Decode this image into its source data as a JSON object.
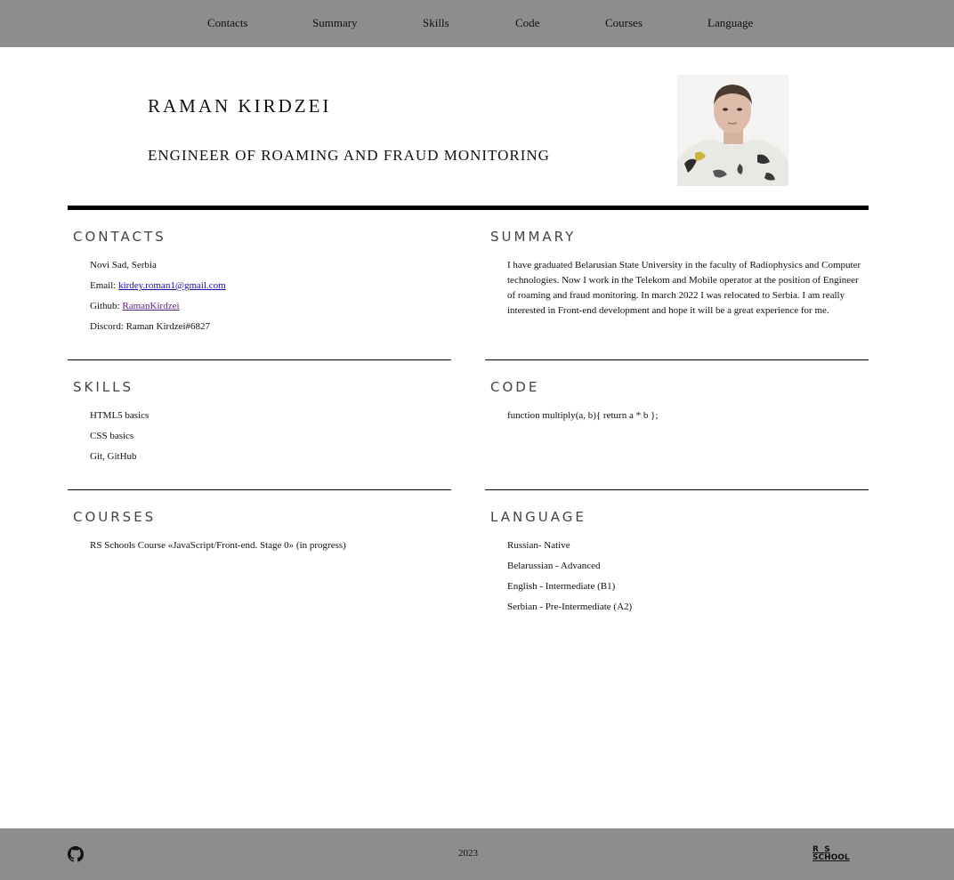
{
  "nav": {
    "items": [
      "Contacts",
      "Summary",
      "Skills",
      "Code",
      "Courses",
      "Language"
    ]
  },
  "header": {
    "name": "RAMAN KIRDZEI",
    "role": "ENGINEER OF ROAMING AND FRAUD MONITORING"
  },
  "contacts": {
    "title": "CONTACTS",
    "location": "Novi Sad, Serbia",
    "email_label": "Email: ",
    "email": "kirdey.roman1@gmail.com",
    "github_label": "Github: ",
    "github": "RamanKirdzei",
    "discord": "Discord: Raman Kirdzei#6827"
  },
  "summary": {
    "title": "SUMMARY",
    "text": "I have graduated Belarusian State University in the faculty of Radiophysics and Computer technologies. Now I work in the Telekom and Mobile operator at the position of Engineer of roaming and fraud monitoring. In march 2022 I was relocated to Serbia. I am really interested in Front-end development and hope it will be a great experience for me."
  },
  "skills": {
    "title": "SKILLS",
    "items": [
      "HTML5 basics",
      "CSS basics",
      "Git, GitHub"
    ]
  },
  "code": {
    "title": "CODE",
    "snippet": "function multiply(a, b){ return a * b };"
  },
  "courses": {
    "title": "COURSES",
    "items": [
      "RS Schools Course «JavaScript/Front-end. Stage 0» (in progress)"
    ]
  },
  "language": {
    "title": "LANGUAGE",
    "items": [
      "Russian- Native",
      "Belarussian - Advanced",
      "English - Intermediate (B1)",
      "Serbian - Pre-Intermediate (A2)"
    ]
  },
  "footer": {
    "year": "2023",
    "logo_line1": "R  S",
    "logo_line2": "SCHOOL"
  },
  "colors": {
    "bar": "#8c8e8c",
    "link": "#1a0dab",
    "visited": "#5a1f7a",
    "heading": "#444444"
  }
}
